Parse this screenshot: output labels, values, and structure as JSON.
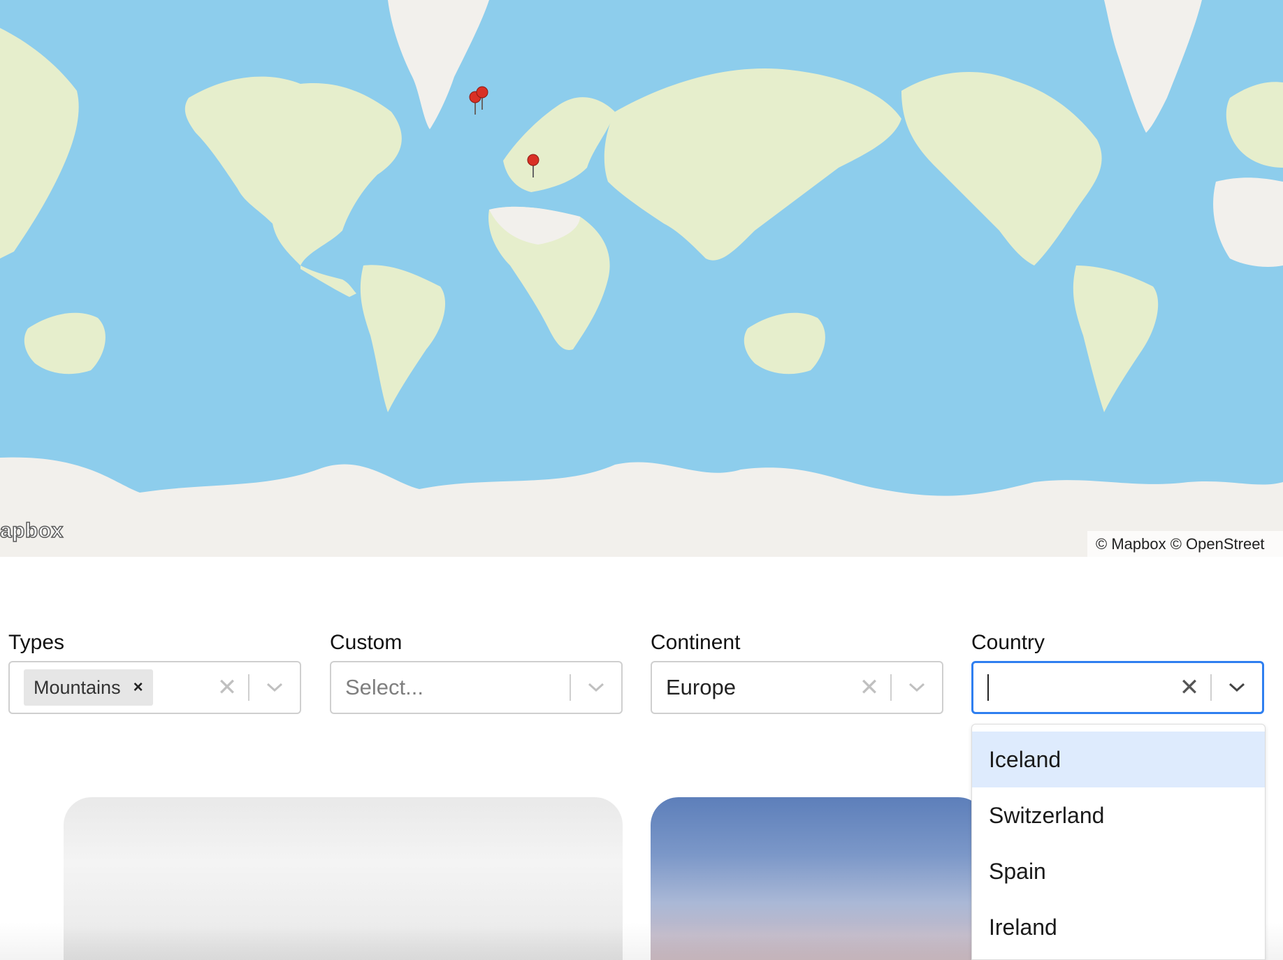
{
  "map": {
    "logo_text": "apbox",
    "attribution": "© Mapbox © OpenStreet",
    "markers": [
      {
        "name": "marker-iceland-1"
      },
      {
        "name": "marker-iceland-2"
      },
      {
        "name": "marker-switzerland"
      }
    ],
    "colors": {
      "water": "#8dcdec",
      "land": "#e6eecc",
      "ice": "#f2f0ec"
    }
  },
  "filters": {
    "types": {
      "label": "Types",
      "selected_chip": "Mountains",
      "chip_remove": "×",
      "clear": "✕"
    },
    "custom": {
      "label": "Custom",
      "placeholder": "Select...",
      "clear": ""
    },
    "continent": {
      "label": "Continent",
      "value": "Europe",
      "clear": "✕"
    },
    "country": {
      "label": "Country",
      "value": "",
      "clear": "✕",
      "options": [
        "Iceland",
        "Switzerland",
        "Spain",
        "Ireland"
      ],
      "highlighted_option": "Iceland"
    }
  },
  "colors": {
    "focus_border": "#2f7ff0",
    "option_highlight": "#deebfd",
    "chip_bg": "#e6e6e6"
  }
}
